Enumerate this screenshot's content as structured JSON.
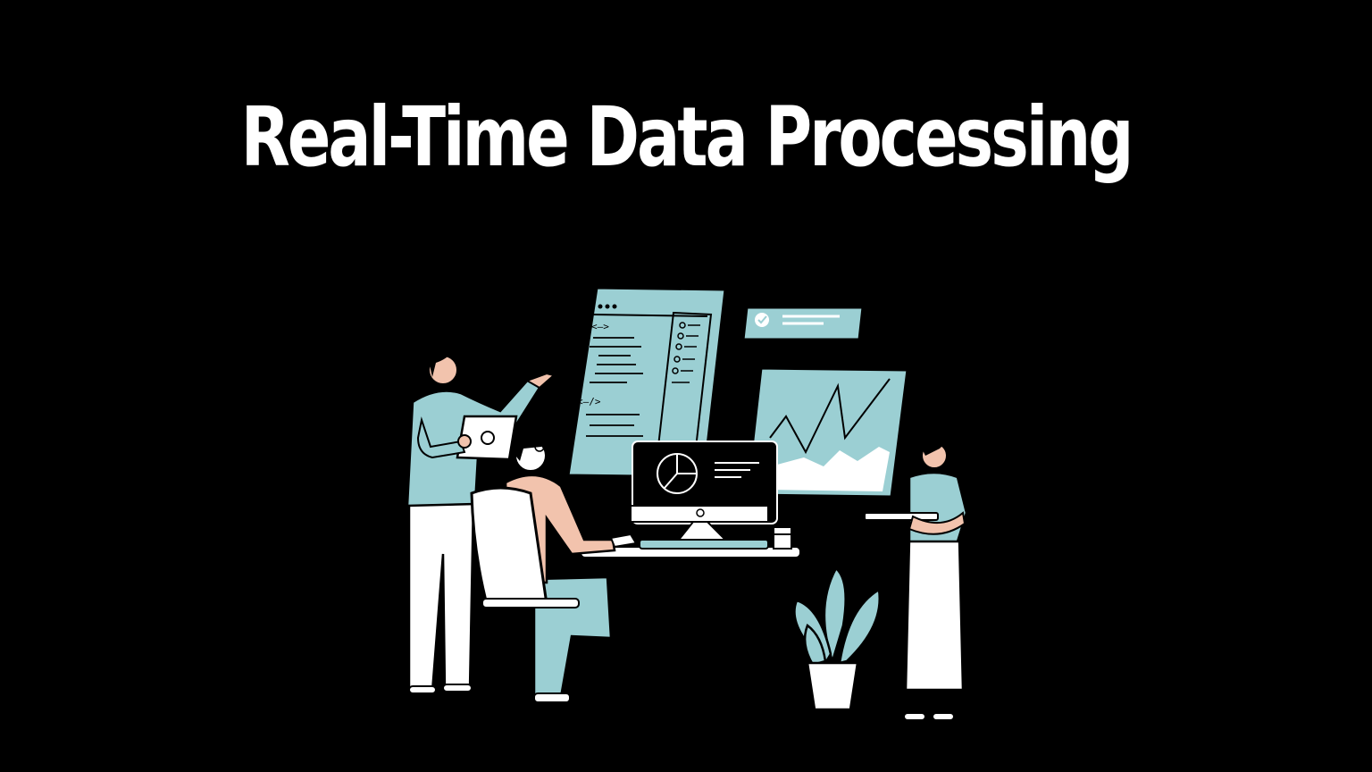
{
  "title": "Real-Time Data Processing",
  "colors": {
    "background": "#000000",
    "accent": "#9bcfd3",
    "skin": "#f2c3ad",
    "outline": "#000000",
    "white": "#ffffff"
  },
  "icons": {
    "code_panel": "code-window-icon",
    "check_badge": "check-circle-icon",
    "line_chart": "line-chart-icon",
    "pie_chart": "pie-chart-icon"
  },
  "code_tags": {
    "open": "<—>",
    "close": "<—/>"
  }
}
